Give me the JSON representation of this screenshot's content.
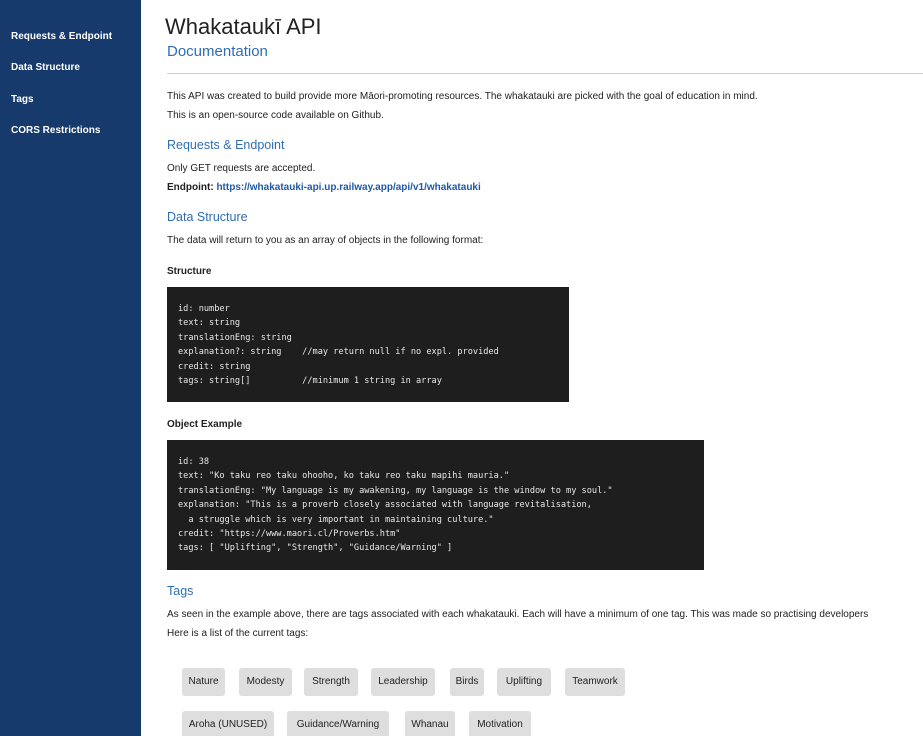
{
  "sidebar": {
    "items": [
      {
        "label": "Requests & Endpoint"
      },
      {
        "label": "Data Structure"
      },
      {
        "label": "Tags"
      },
      {
        "label": "CORS Restrictions"
      }
    ]
  },
  "header": {
    "title": "Whakataukī API",
    "subtitle": "Documentation"
  },
  "intro": {
    "line1": "This API was created to build provide more Māori-promoting resources. The whakatauki are picked with the goal of education in mind.",
    "line2": "This is an open-source code available on Github."
  },
  "requests": {
    "heading": "Requests & Endpoint",
    "text": "Only GET requests are accepted.",
    "endpoint_label": "Endpoint:",
    "endpoint_url": "https://whakatauki-api.up.railway.app/api/v1/whakatauki"
  },
  "data_structure": {
    "heading": "Data Structure",
    "text": "The data will return to you as an array of objects in the following format:",
    "structure_heading": "Structure",
    "structure_code": "id: number\ntext: string\ntranslationEng: string\nexplanation?: string    //may return null if no expl. provided\ncredit: string\ntags: string[]          //minimum 1 string in array",
    "example_heading": "Object Example",
    "example_code": "id: 38\ntext: \"Ko taku reo taku ohooho, ko taku reo taku mapihi mauria.\"\ntranslationEng: \"My language is my awakening, my language is the window to my soul.\"\nexplanation: \"This is a proverb closely associated with language revitalisation,\n  a struggle which is very important in maintaining culture.\"\ncredit: \"https://www.maori.cl/Proverbs.htm\"\ntags: [ \"Uplifting\", \"Strength\", \"Guidance/Warning\" ]"
  },
  "tags_section": {
    "heading": "Tags",
    "text": "As seen in the example above, there are tags associated with each whakatauki. Each will have a minimum of one tag. This was made so practising developers",
    "list_intro": "Here is a list of the current tags:",
    "row1": [
      "Nature",
      "Modesty",
      "Strength",
      "Leadership",
      "Birds",
      "Uplifting",
      "Teamwork"
    ],
    "row2": [
      "Aroha (UNUSED)",
      "Guidance/Warning",
      "Whanau",
      "Motivation"
    ]
  }
}
